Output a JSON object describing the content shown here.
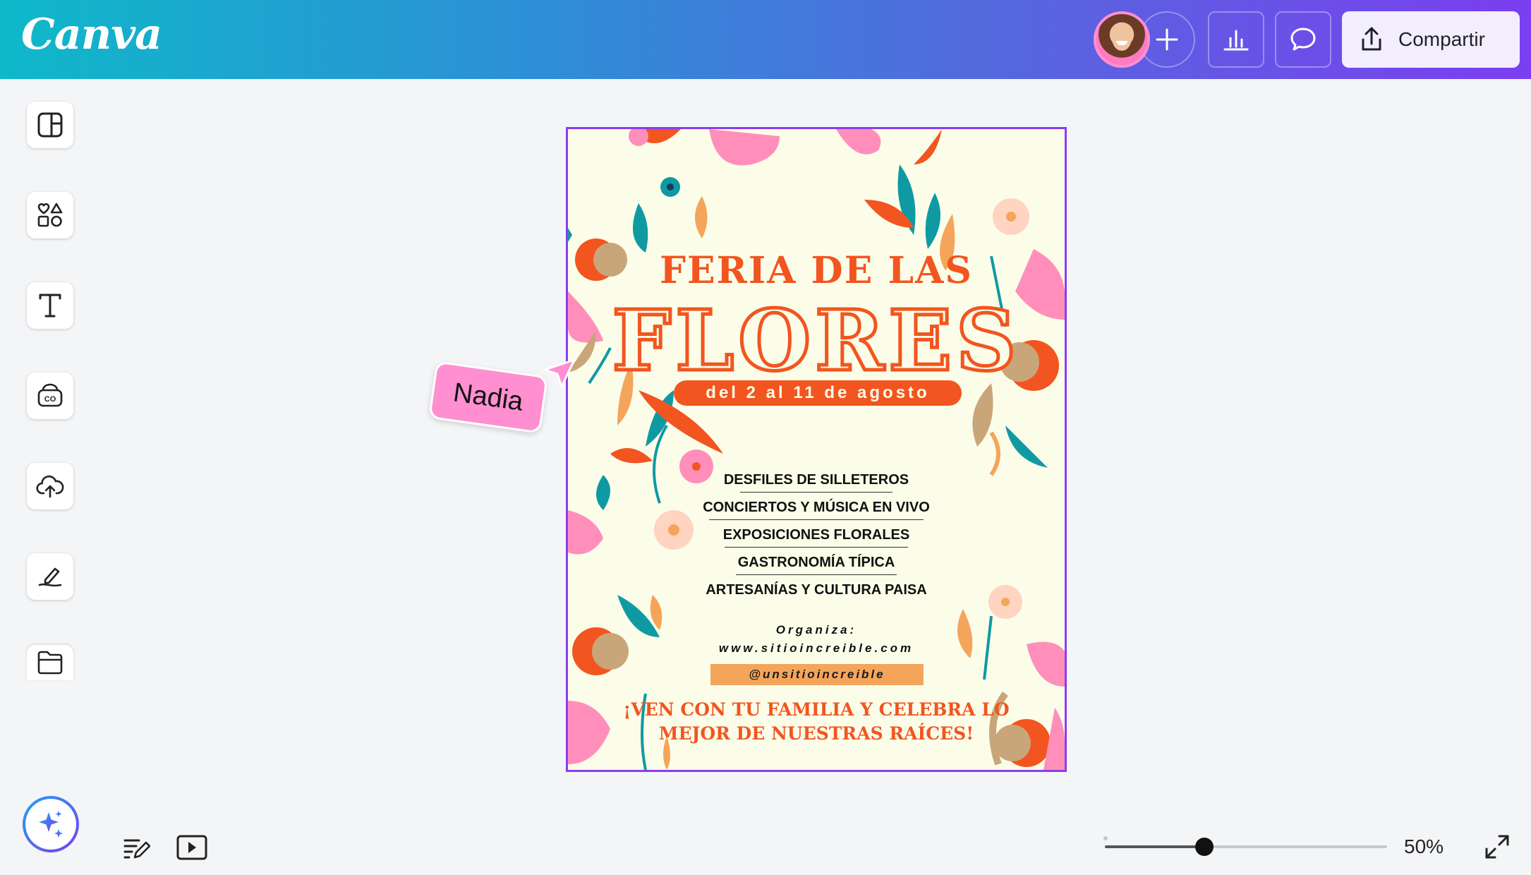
{
  "app": {
    "logo": "Canva"
  },
  "topbar": {
    "share_label": "Compartir",
    "icons": [
      "avatar",
      "plus-icon",
      "analytics-icon",
      "comment-icon",
      "share-upload-icon"
    ]
  },
  "left_rail": {
    "items": [
      {
        "name": "design",
        "icon": "layout-icon"
      },
      {
        "name": "elements",
        "icon": "shapes-icon"
      },
      {
        "name": "text",
        "icon": "text-icon"
      },
      {
        "name": "brand",
        "icon": "brand-kit-icon"
      },
      {
        "name": "uploads",
        "icon": "cloud-upload-icon"
      },
      {
        "name": "draw",
        "icon": "pen-draw-icon"
      },
      {
        "name": "projects",
        "icon": "folder-icon"
      }
    ]
  },
  "poster": {
    "title_line1": "FERIA DE LAS",
    "title_line2": "FLORES",
    "dates": "del 2 al 11 de agosto",
    "events": [
      "DESFILES DE SILLETEROS",
      "CONCIERTOS Y MÚSICA EN VIVO",
      "EXPOSICIONES FLORALES",
      "GASTRONOMÍA TÍPICA",
      "ARTESANÍAS Y CULTURA PAISA"
    ],
    "organizer_label": "Organiza:",
    "website": "www.sitioincreible.com",
    "handle": "@unsitioincreible",
    "cta_line1": "¡VEN CON TU FAMILIA Y CELEBRA LO",
    "cta_line2": "MEJOR DE NUESTRAS RAÍCES!"
  },
  "collaborator": {
    "name": "Nadia",
    "color": "#ff8fd0"
  },
  "bottom": {
    "zoom_label": "50%",
    "zoom_value": 0.5
  },
  "colors": {
    "accent": "#f2551f",
    "selection": "#8b3cf0",
    "poster_bg": "#fbfde9"
  }
}
